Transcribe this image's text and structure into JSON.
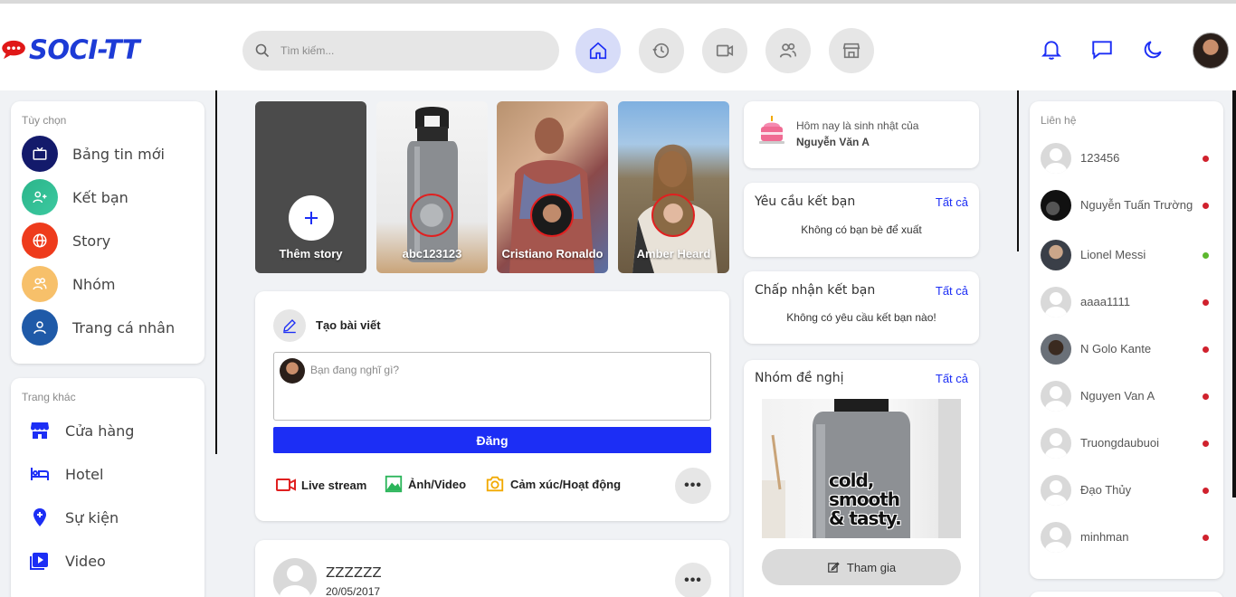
{
  "app": {
    "logo": "SOCI-TT"
  },
  "search": {
    "placeholder": "Tìm kiếm..."
  },
  "nav": [
    {
      "name": "home",
      "icon": "home-icon",
      "active": true
    },
    {
      "name": "history",
      "icon": "history-icon"
    },
    {
      "name": "video",
      "icon": "video-icon"
    },
    {
      "name": "friends",
      "icon": "friends-icon"
    },
    {
      "name": "store",
      "icon": "store-icon"
    }
  ],
  "sidebar": {
    "options_label": "Tùy chọn",
    "options": [
      {
        "label": "Bảng tin mới",
        "icon": "tv-icon",
        "color": "#131a6b"
      },
      {
        "label": "Kết bạn",
        "icon": "add-friend-icon",
        "color": "#2bb58a"
      },
      {
        "label": "Story",
        "icon": "globe-icon",
        "color": "#ee3b1c"
      },
      {
        "label": "Nhóm",
        "icon": "group-icon",
        "color": "#f7c06a"
      },
      {
        "label": "Trang cá nhân",
        "icon": "user-icon",
        "color": "#1f5aa8"
      }
    ],
    "other_label": "Trang khác",
    "others": [
      {
        "label": "Cửa hàng",
        "icon": "shop-icon"
      },
      {
        "label": "Hotel",
        "icon": "bed-icon"
      },
      {
        "label": "Sự kiện",
        "icon": "location-icon"
      },
      {
        "label": "Video",
        "icon": "play-icon"
      }
    ]
  },
  "stories": {
    "add_label": "Thêm story",
    "items": [
      {
        "name": "abc123123"
      },
      {
        "name": "Cristiano Ronaldo"
      },
      {
        "name": "Amber Heard"
      }
    ]
  },
  "composer": {
    "title": "Tạo bài viết",
    "placeholder": "Bạn đang nghĩ gì?",
    "post_button": "Đăng",
    "actions": [
      {
        "label": "Live stream",
        "icon": "live-icon",
        "color": "#e02020"
      },
      {
        "label": "Ảnh/Video",
        "icon": "image-icon",
        "color": "#2bb55a"
      },
      {
        "label": "Cảm xúc/Hoạt động",
        "icon": "camera-icon",
        "color": "#f2a900"
      }
    ],
    "more": "•••"
  },
  "post": {
    "author": "ZZZZZZ",
    "date": "20/05/2017",
    "more": "•••"
  },
  "birthday": {
    "text": "Hôm nay là sinh nhật của",
    "name": "Nguyễn Văn A"
  },
  "friend_requests": {
    "title": "Yêu cầu kết bạn",
    "link": "Tất cả",
    "empty": "Không có bạn bè để xuất"
  },
  "accept_requests": {
    "title": "Chấp nhận kết bạn",
    "link": "Tất cả",
    "empty": "Không có yêu cầu kết bạn nào!"
  },
  "groups": {
    "title": "Nhóm đề nghị",
    "link": "Tất cả",
    "bottle_text": [
      "cold,",
      "smooth",
      "& tasty."
    ],
    "join": "Tham gia"
  },
  "contacts": {
    "label": "Liên hệ",
    "items": [
      {
        "name": "123456",
        "status": "offline"
      },
      {
        "name": "Nguyễn Tuấn Trường",
        "status": "offline"
      },
      {
        "name": "Lionel Messi",
        "status": "online"
      },
      {
        "name": "aaaa1111",
        "status": "offline"
      },
      {
        "name": "N Golo Kante",
        "status": "offline"
      },
      {
        "name": "Nguyen Van A",
        "status": "offline"
      },
      {
        "name": "Truongdaubuoi",
        "status": "offline"
      },
      {
        "name": "Đạo Thủy",
        "status": "offline"
      },
      {
        "name": "minhman",
        "status": "offline"
      }
    ]
  },
  "colors": {
    "accent": "#1c2ef5",
    "online": "#5cb82e",
    "offline": "#d0212d"
  }
}
